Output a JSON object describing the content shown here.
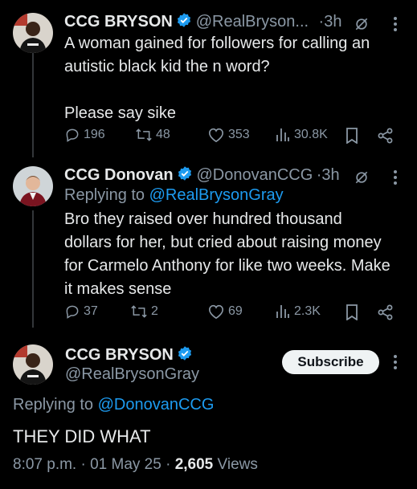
{
  "tweets": [
    {
      "author_name": "CCG BRYSON",
      "handle": "@RealBryson...",
      "time": "·3h",
      "text": [
        "A woman gained for followers for calling an",
        "autistic black kid the n word?",
        "",
        "Please say sike"
      ],
      "stats": {
        "replies": "196",
        "retweets": "48",
        "likes": "353",
        "views": "30.8K"
      }
    },
    {
      "author_name": "CCG Donovan",
      "handle": "@DonovanCCG",
      "time": "·3h",
      "replying_label": "Replying to",
      "replying_to": "@RealBrysonGray",
      "text": [
        "Bro they raised over hundred thousand",
        "dollars for her, but cried about raising money",
        "for Carmelo Anthony for like two weeks. Make",
        "it makes sense"
      ],
      "stats": {
        "replies": "37",
        "retweets": "2",
        "likes": "69",
        "views": "2.3K"
      }
    }
  ],
  "main": {
    "author_name": "CCG BRYSON",
    "handle": "@RealBrysonGray",
    "subscribe_label": "Subscribe",
    "replying_label": "Replying to",
    "replying_to": "@DonovanCCG",
    "text": "THEY DID WHAT",
    "timestamp": "8:07 p.m. · 01 May 25 · ",
    "views_count": "2,605",
    "views_label": "Views"
  },
  "colors": {
    "background": "#000000",
    "text": "#e7e9ea",
    "muted": "#8b98a5",
    "link": "#1d9bf0",
    "verified": "#1d9bf0"
  },
  "icons": [
    "reply-icon",
    "retweet-icon",
    "like-icon",
    "views-icon",
    "bookmark-icon",
    "share-icon",
    "grok-icon",
    "more-icon",
    "verified-icon"
  ]
}
